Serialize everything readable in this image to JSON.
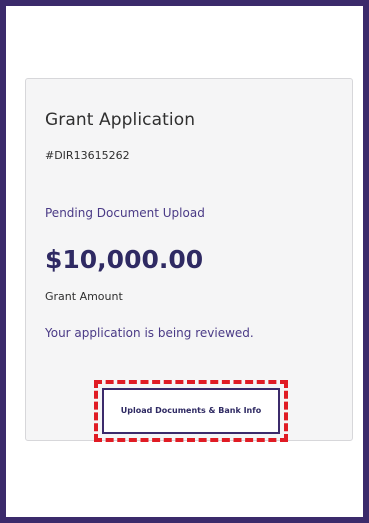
{
  "card": {
    "title": "Grant Application",
    "application_id": "#DIR13615262",
    "status": "Pending Document Upload",
    "amount": "$10,000.00",
    "amount_label": "Grant Amount",
    "message": "Your application is being reviewed.",
    "upload_button_label": "Upload Documents & Bank Info"
  },
  "colors": {
    "frame_border": "#3b2a6b",
    "accent_purple": "#4a3a86",
    "highlight_red": "#e01b24",
    "card_background": "#f5f5f6"
  }
}
